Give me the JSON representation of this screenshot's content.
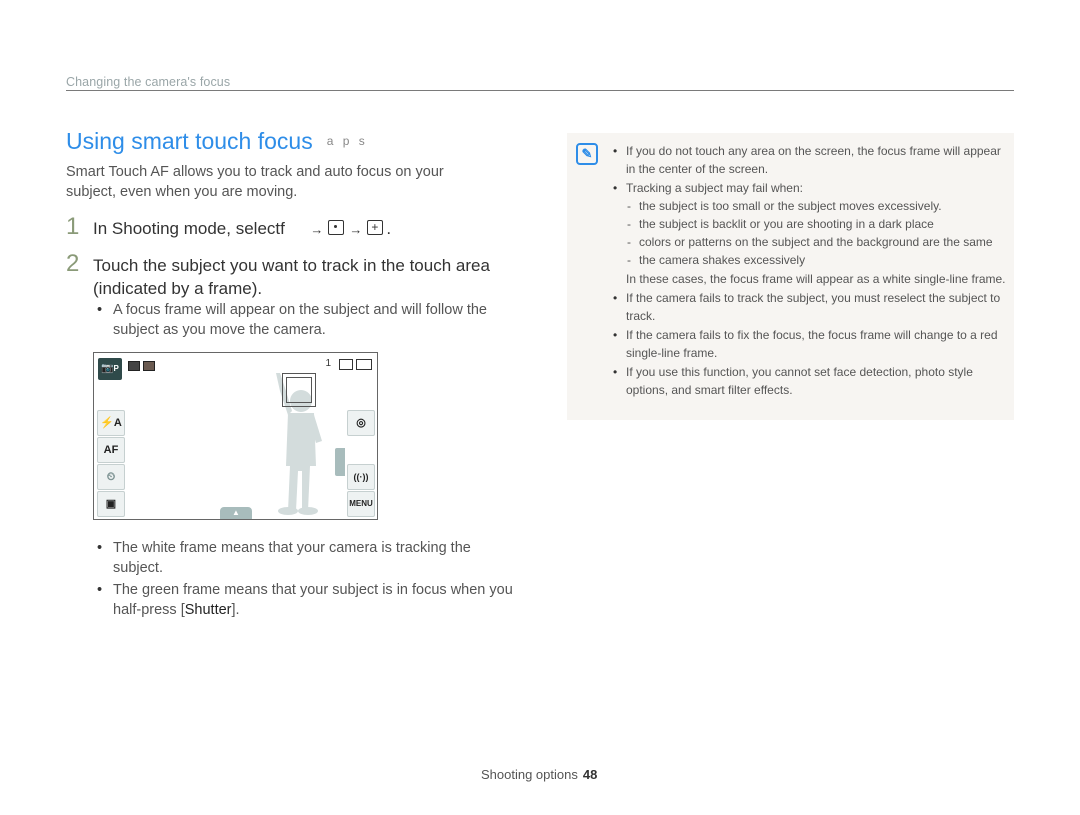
{
  "header": {
    "section": "Changing the camera's focus"
  },
  "title": {
    "text": "Using smart touch focus",
    "modes": "a p s"
  },
  "intro": "Smart Touch AF allows you to track and auto focus on your subject, even when you are moving.",
  "steps": [
    {
      "num": "1",
      "text_before": "In Shooting mode, select",
      "text_key": "f",
      "arrow": "→",
      "end": "."
    },
    {
      "num": "2",
      "text": "Touch the subject you want to track in the touch area (indicated by a frame)."
    }
  ],
  "step2_bullets": [
    "A focus frame will appear on the subject and will follow the subject as you move the camera."
  ],
  "camera_screen": {
    "mode_label": "P",
    "shot_count": "1",
    "left_buttons": [
      {
        "label": "⚡A",
        "icon": "flash-auto-icon"
      },
      {
        "label": "AF",
        "icon": "af-icon"
      },
      {
        "label": "⏲",
        "icon": "timer-off-icon"
      },
      {
        "label": "▣",
        "icon": "display-icon"
      }
    ],
    "right_buttons": [
      {
        "label": "◎",
        "icon": "ois-icon"
      },
      {
        "label": "((·))",
        "icon": "wireless-icon"
      },
      {
        "label": "MENU",
        "icon": "menu-icon"
      }
    ],
    "bottom_tab": "▲",
    "side_tab": "▸"
  },
  "frame_bullets": [
    {
      "text": "The white frame means that your camera is tracking the subject."
    },
    {
      "text_before": "The green frame means that your subject is in focus when you half-press [",
      "bold": "Shutter",
      "text_after": "]."
    }
  ],
  "note": {
    "icon": "note-icon",
    "items": [
      {
        "type": "bullet",
        "text": "If you do not touch any area on the screen, the focus frame will appear in the center of the screen."
      },
      {
        "type": "bullet",
        "text": "Tracking a subject may fail when:"
      },
      {
        "type": "sub",
        "items": [
          "the subject is too small or the subject moves excessively.",
          "the subject is backlit or you are shooting in a dark place",
          "colors or patterns on the subject and the background are the same",
          "the camera shakes excessively"
        ]
      },
      {
        "type": "plain",
        "text": "In these cases, the focus frame will appear as a white single-line frame."
      },
      {
        "type": "bullet",
        "text": "If the camera fails to track the subject, you must reselect the subject to track."
      },
      {
        "type": "bullet",
        "text": "If the camera fails to fix the focus, the focus frame will change to a red single-line frame."
      },
      {
        "type": "bullet",
        "text": "If you use this function, you cannot set face detection, photo style options, and smart filter effects."
      }
    ]
  },
  "footer": {
    "section": "Shooting options",
    "page": "48"
  },
  "colors": {
    "accent": "#2e8de8",
    "note_bg": "#f7f5f2",
    "step_num": "#8a9a78"
  }
}
